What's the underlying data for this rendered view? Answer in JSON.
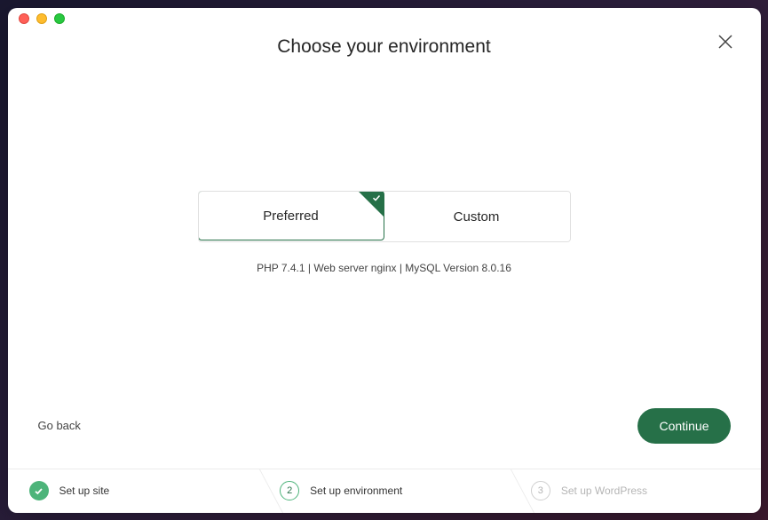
{
  "header": {
    "title": "Choose your environment"
  },
  "options": {
    "preferred": {
      "label": "Preferred",
      "selected": true
    },
    "custom": {
      "label": "Custom",
      "selected": false
    }
  },
  "detail_line": "PHP 7.4.1 | Web server nginx | MySQL Version 8.0.16",
  "footer": {
    "go_back": "Go back",
    "continue": "Continue"
  },
  "steps": {
    "one": {
      "label": "Set up site",
      "state": "done"
    },
    "two": {
      "number": "2",
      "label": "Set up environment",
      "state": "active"
    },
    "three": {
      "number": "3",
      "label": "Set up WordPress",
      "state": "pending"
    }
  }
}
